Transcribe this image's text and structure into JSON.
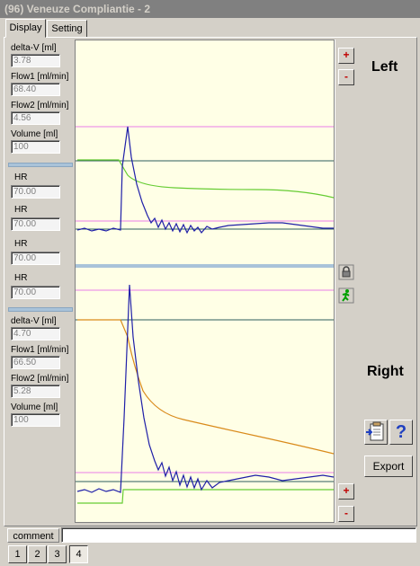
{
  "window": {
    "title": "(96) Veneuze Compliantie - 2"
  },
  "tabs": [
    {
      "label": "Display",
      "active": true
    },
    {
      "label": "Setting",
      "active": false
    }
  ],
  "left_fields_top": [
    {
      "label": "delta-V [ml]",
      "value": "3.78"
    },
    {
      "label": "Flow1 [ml/min]",
      "value": "68.40"
    },
    {
      "label": "Flow2 [ml/min]",
      "value": "4.56"
    },
    {
      "label": "Volume [ml]",
      "value": "100"
    }
  ],
  "hr_fields": [
    {
      "label": "HR",
      "value": "70.00"
    },
    {
      "label": "HR",
      "value": "70.00"
    },
    {
      "label": "HR",
      "value": "70.00"
    },
    {
      "label": "HR",
      "value": "70.00"
    }
  ],
  "left_fields_bottom": [
    {
      "label": "delta-V [ml]",
      "value": "4.70"
    },
    {
      "label": "Flow1 [ml/min]",
      "value": "66.50"
    },
    {
      "label": "Flow2 [ml/min]",
      "value": "5.28"
    },
    {
      "label": "Volume [ml]",
      "value": "100"
    }
  ],
  "scroll_buttons": {
    "plus": "+",
    "minus": "-"
  },
  "side_labels": {
    "left": "Left",
    "right": "Right"
  },
  "buttons": {
    "export": "Export",
    "help": "?"
  },
  "comment": {
    "label": "comment",
    "value": ""
  },
  "page_tabs": [
    {
      "label": "1"
    },
    {
      "label": "2"
    },
    {
      "label": "3"
    },
    {
      "label": "4",
      "active": true
    }
  ],
  "colors": {
    "chart_bg": "#ffffe6",
    "flow_line": "#1f1fa8",
    "green_line": "#66cc33",
    "orange_line": "#d98a1a",
    "ref_line": "#2e5e5e",
    "pink_line": "#e87ce8",
    "separator": "#a9c3d9"
  }
}
